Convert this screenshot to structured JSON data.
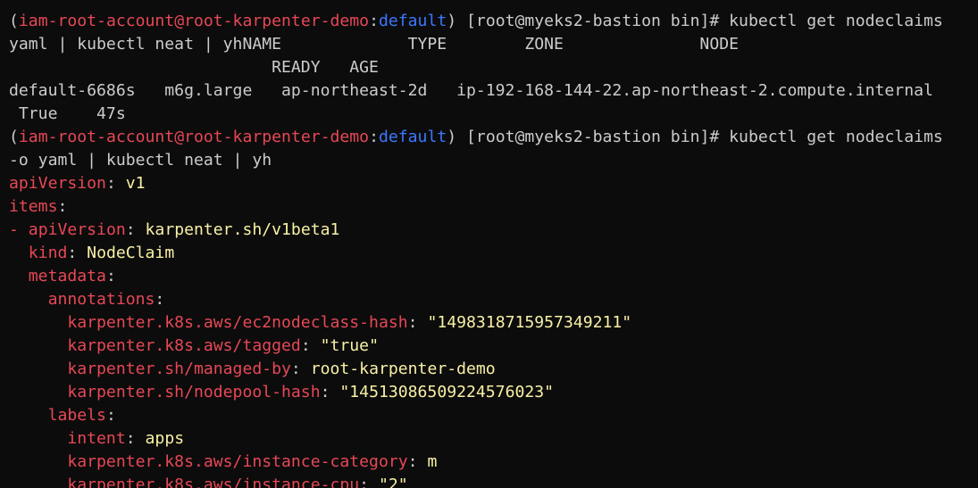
{
  "colors": {
    "background": "#0c0c0c",
    "foreground": "#cccccc",
    "key_red": "#e74856",
    "namespace_blue": "#3b78ff",
    "value_yellow": "#f9f1a5"
  },
  "terminal": {
    "lines": [
      [
        {
          "t": "~",
          "c": "white"
        }
      ],
      [
        {
          "t": "(",
          "c": "white"
        },
        {
          "t": "iam-root-account@root-karpenter-demo",
          "c": "red"
        },
        {
          "t": ":",
          "c": "white"
        },
        {
          "t": "default",
          "c": "blue"
        },
        {
          "t": ") [root@myeks2-bastion bin]# kubectl get nodeclaims",
          "c": "white"
        }
      ],
      [
        {
          "t": "yaml | kubectl neat | yhNAME             TYPE        ZONE              NODE",
          "c": "white"
        }
      ],
      [
        {
          "t": "                           READY   AGE",
          "c": "white"
        }
      ],
      [
        {
          "t": "default-6686s   m6g.large   ap-northeast-2d   ip-192-168-144-22.ap-northeast-2.compute.internal",
          "c": "white"
        }
      ],
      [
        {
          "t": " True    47s",
          "c": "white"
        }
      ],
      [
        {
          "t": "(",
          "c": "white"
        },
        {
          "t": "iam-root-account@root-karpenter-demo",
          "c": "red"
        },
        {
          "t": ":",
          "c": "white"
        },
        {
          "t": "default",
          "c": "blue"
        },
        {
          "t": ") [root@myeks2-bastion bin]# kubectl get nodeclaims",
          "c": "white"
        }
      ],
      [
        {
          "t": "-o yaml | kubectl neat | yh",
          "c": "white"
        }
      ],
      [
        {
          "t": "apiVersion",
          "c": "red"
        },
        {
          "t": ": ",
          "c": "white"
        },
        {
          "t": "v1",
          "c": "yellow"
        }
      ],
      [
        {
          "t": "items",
          "c": "red"
        },
        {
          "t": ":",
          "c": "white"
        }
      ],
      [
        {
          "t": "- ",
          "c": "red"
        },
        {
          "t": "apiVersion",
          "c": "red"
        },
        {
          "t": ": ",
          "c": "white"
        },
        {
          "t": "karpenter.sh/v1beta1",
          "c": "yellow"
        }
      ],
      [
        {
          "t": "  kind",
          "c": "red"
        },
        {
          "t": ": ",
          "c": "white"
        },
        {
          "t": "NodeClaim",
          "c": "yellow"
        }
      ],
      [
        {
          "t": "  metadata",
          "c": "red"
        },
        {
          "t": ":",
          "c": "white"
        }
      ],
      [
        {
          "t": "    annotations",
          "c": "red"
        },
        {
          "t": ":",
          "c": "white"
        }
      ],
      [
        {
          "t": "      karpenter.k8s.aws/ec2nodeclass-hash",
          "c": "red"
        },
        {
          "t": ": ",
          "c": "white"
        },
        {
          "t": "\"14983187159573492​11\"",
          "c": "yellow"
        }
      ],
      [
        {
          "t": "      karpenter.k8s.aws/tagged",
          "c": "red"
        },
        {
          "t": ": ",
          "c": "white"
        },
        {
          "t": "\"true\"",
          "c": "yellow"
        }
      ],
      [
        {
          "t": "      karpenter.sh/managed-by",
          "c": "red"
        },
        {
          "t": ": ",
          "c": "white"
        },
        {
          "t": "root-karpenter-demo",
          "c": "yellow"
        }
      ],
      [
        {
          "t": "      karpenter.sh/nodepool-hash",
          "c": "red"
        },
        {
          "t": ": ",
          "c": "white"
        },
        {
          "t": "\"14513086509224576023\"",
          "c": "yellow"
        }
      ],
      [
        {
          "t": "    labels",
          "c": "red"
        },
        {
          "t": ":",
          "c": "white"
        }
      ],
      [
        {
          "t": "      intent",
          "c": "red"
        },
        {
          "t": ": ",
          "c": "white"
        },
        {
          "t": "apps",
          "c": "yellow"
        }
      ],
      [
        {
          "t": "      karpenter.k8s.aws/instance-category",
          "c": "red"
        },
        {
          "t": ": ",
          "c": "white"
        },
        {
          "t": "m",
          "c": "yellow"
        }
      ],
      [
        {
          "t": "      karpenter.k8s.aws/instance-cpu",
          "c": "red"
        },
        {
          "t": ": ",
          "c": "white"
        },
        {
          "t": "\"2\"",
          "c": "yellow"
        }
      ]
    ]
  }
}
